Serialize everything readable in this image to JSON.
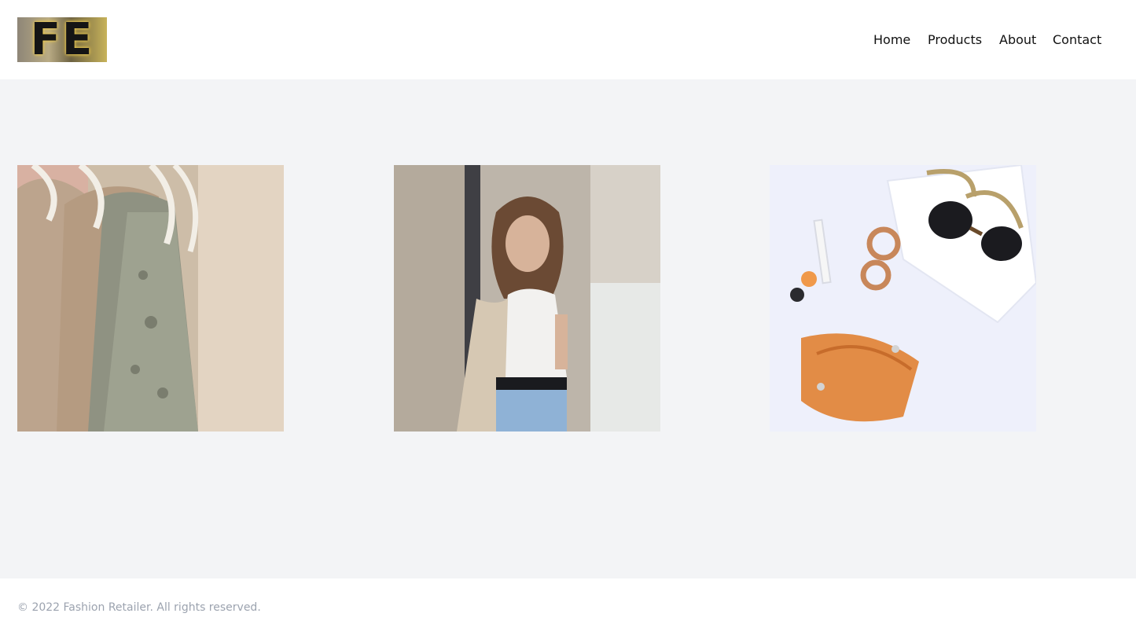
{
  "header": {
    "logo_text": "FE",
    "nav": {
      "home": "Home",
      "products": "Products",
      "about": "About",
      "contact": "Contact"
    }
  },
  "gallery": {
    "images": [
      {
        "subject": "clothes-on-hangers-photo"
      },
      {
        "subject": "woman-fashion-portrait-photo"
      },
      {
        "subject": "accessories-flatlay-photo"
      }
    ]
  },
  "footer": {
    "copyright": "© 2022 Fashion Retailer. All rights reserved."
  },
  "colors": {
    "page_background": "#f3f4f6",
    "header_background": "#ffffff",
    "footer_text": "#9ca3af",
    "nav_text": "#111111"
  }
}
